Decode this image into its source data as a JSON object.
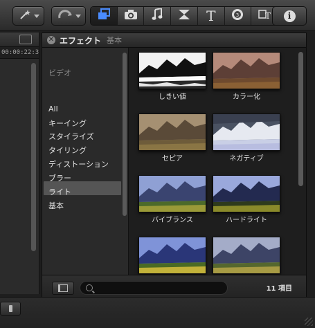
{
  "toolbar": {
    "icons": [
      "magic-wand-icon",
      "retime-icon",
      "photos-icon",
      "camera-icon",
      "music-icon",
      "transitions-icon",
      "titles-icon",
      "generators-icon",
      "themes-icon",
      "info-icon"
    ],
    "accent_color": "#4a8cff"
  },
  "left_panel": {
    "timecode": "00:00:22:3"
  },
  "effects": {
    "title": "エフェクト",
    "breadcrumb": "基本",
    "category_heading": "ビデオ",
    "categories": [
      "All",
      "キーイング",
      "スタイライズ",
      "タイリング",
      "ディストーション",
      "ブラー",
      "ライト",
      "基本"
    ],
    "selected_category": "基本",
    "items": [
      {
        "label": "しきい値",
        "style": "threshold"
      },
      {
        "label": "カラー化",
        "style": "colorize"
      },
      {
        "label": "セピア",
        "style": "sepia"
      },
      {
        "label": "ネガティブ",
        "style": "negative"
      },
      {
        "label": "バイブランス",
        "style": "vibrance"
      },
      {
        "label": "ハードライト",
        "style": "hardlight"
      },
      {
        "label": "",
        "style": "normal"
      },
      {
        "label": "",
        "style": "normal2"
      }
    ],
    "search": {
      "value": "",
      "placeholder": ""
    },
    "item_count": "11 項目"
  }
}
